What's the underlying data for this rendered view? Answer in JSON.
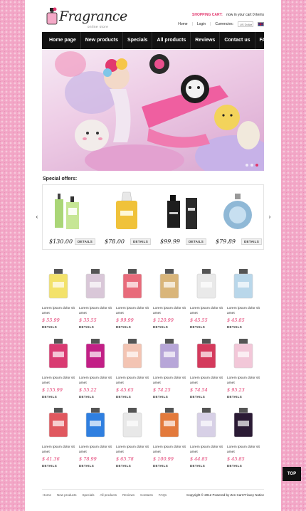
{
  "header": {
    "logo_text": "Fragrance",
    "logo_subtitle": "online store",
    "cart_label": "SHOPPING CART:",
    "cart_text": "now in your cart 0 items",
    "links": [
      "Home",
      "Login"
    ],
    "currencies_label": "Currencies:",
    "currency_value": "US Dollar",
    "language_flag": "uk-flag-icon"
  },
  "nav": {
    "items": [
      "Home page",
      "New products",
      "Specials",
      "All products",
      "Reviews",
      "Contact us",
      "FAQs"
    ]
  },
  "banner": {
    "slides_total": 3,
    "active_slide": 1
  },
  "special_offers": {
    "title": "Special offers:",
    "prev_icon": "chevron-left-icon",
    "next_icon": "chevron-right-icon",
    "items": [
      {
        "price": "$130.00",
        "details_label": "DETAILS",
        "color": "#9bcf5f"
      },
      {
        "price": "$78.00",
        "details_label": "DETAILS",
        "color": "#f0c23a"
      },
      {
        "price": "$99.99",
        "details_label": "DETAILS",
        "color": "#222222"
      },
      {
        "price": "$79.89",
        "details_label": "DETAILS",
        "color": "#8fb8d6"
      }
    ]
  },
  "products": [
    {
      "name": "Lorem ipsum dolor sit amet",
      "price": "$ 55.99",
      "details_label": "DETAILS"
    },
    {
      "name": "Lorem ipsum dolor sit amet",
      "price": "$ 35.55",
      "details_label": "DETAILS"
    },
    {
      "name": "Lorem ipsum dolor sit amet",
      "price": "$ 99.99",
      "details_label": "DETAILS"
    },
    {
      "name": "Lorem ipsum dolor sit amet",
      "price": "$ 120.99",
      "details_label": "DETAILS"
    },
    {
      "name": "Lorem ipsum dolor sit amet",
      "price": "$ 45.55",
      "details_label": "DETAILS"
    },
    {
      "name": "Lorem ipsum dolor sit amet",
      "price": "$ 45.85",
      "details_label": "DETAILS"
    },
    {
      "name": "Lorem ipsum dolor sit amet",
      "price": "$ 155.99",
      "details_label": "DETAILS"
    },
    {
      "name": "Lorem ipsum dolor sit amet",
      "price": "$ 55.22",
      "details_label": "DETAILS"
    },
    {
      "name": "Lorem ipsum dolor sit amet",
      "price": "$ 45.65",
      "details_label": "DETAILS"
    },
    {
      "name": "Lorem ipsum dolor sit amet",
      "price": "$ 74.25",
      "details_label": "DETAILS"
    },
    {
      "name": "Lorem ipsum dolor sit amet",
      "price": "$ 74.54",
      "details_label": "DETAILS"
    },
    {
      "name": "Lorem ipsum dolor sit amet",
      "price": "$ 95.23",
      "details_label": "DETAILS"
    },
    {
      "name": "Lorem ipsum dolor sit amet",
      "price": "$ 41.36",
      "details_label": "DETAILS"
    },
    {
      "name": "Lorem ipsum dolor sit amet",
      "price": "$ 78.99",
      "details_label": "DETAILS"
    },
    {
      "name": "Lorem ipsum dolor sit amet",
      "price": "$ 65.78",
      "details_label": "DETAILS"
    },
    {
      "name": "Lorem ipsum dolor sit amet",
      "price": "$ 100.99",
      "details_label": "DETAILS"
    },
    {
      "name": "Lorem ipsum dolor sit amet",
      "price": "$ 44.85",
      "details_label": "DETAILS"
    },
    {
      "name": "Lorem ipsum dolor sit amet",
      "price": "$ 45.85",
      "details_label": "DETAILS"
    }
  ],
  "product_colors": [
    "#f3e26a",
    "#d9c7d8",
    "#e86b7b",
    "#d9b57a",
    "#e9e9e9",
    "#b9d7ea",
    "#d93b72",
    "#c21f86",
    "#f3c4b3",
    "#b7a6d8",
    "#d43a5c",
    "#f2c7d8",
    "#e0585f",
    "#2f7fe0",
    "#e8e8e8",
    "#e37a3c",
    "#d7d0e6",
    "#2b1b35"
  ],
  "footer": {
    "links": [
      "Home",
      "New products",
      "Specials",
      "All products",
      "Reviews",
      "Contacts",
      "FAQs"
    ],
    "copyright": "Copyright © 2012 Powered by Zen Cart Privacy Notice"
  },
  "top_button_label": "TOP",
  "accent_color": "#e2386e"
}
